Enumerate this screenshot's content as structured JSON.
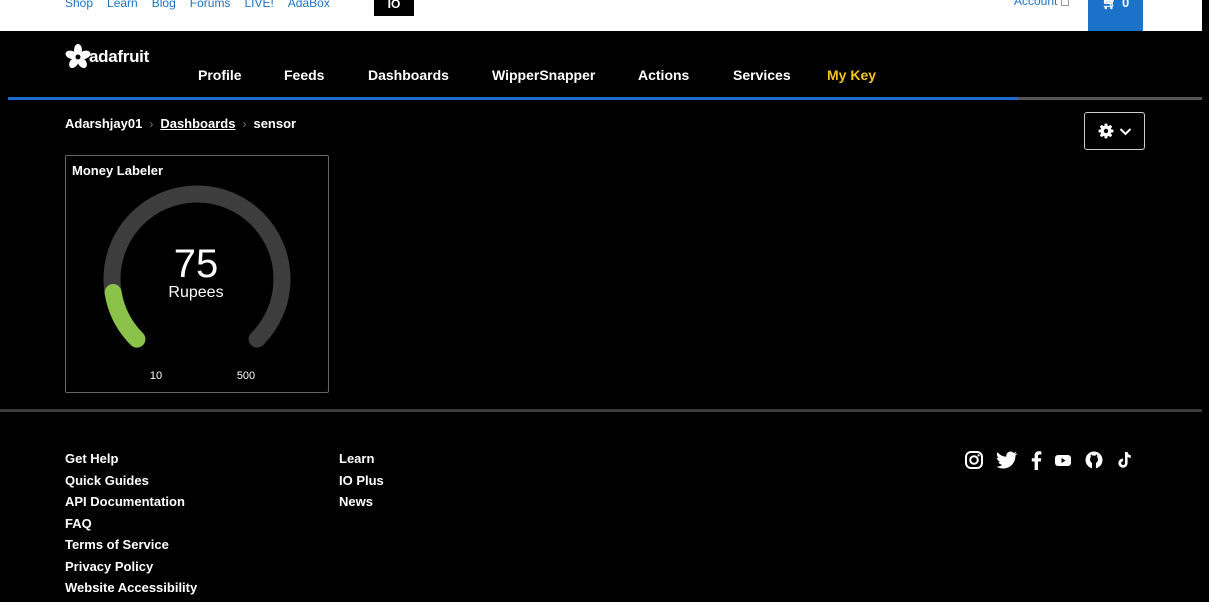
{
  "topbar": {
    "links": [
      "Shop",
      "Learn",
      "Blog",
      "Forums",
      "LIVE!",
      "AdaBox"
    ],
    "io_tab": "IO",
    "account": "Account",
    "cart_count": "0"
  },
  "brand": {
    "name": "adafruit"
  },
  "nav": {
    "items": [
      "Profile",
      "Feeds",
      "Dashboards",
      "WipperSnapper",
      "Actions",
      "Services"
    ],
    "highlight": "My Key",
    "highlight_color": "#f5c518"
  },
  "breadcrumb": {
    "user": "Adarshjay01",
    "section": "Dashboards",
    "current": "sensor"
  },
  "widget": {
    "title": "Money Labeler",
    "value": "75",
    "unit": "Rupees",
    "min": "10",
    "max": "500",
    "fill_fraction": 0.1327,
    "fill_color": "#8bc34a"
  },
  "footer": {
    "col1": [
      "Get Help",
      "Quick Guides",
      "API Documentation",
      "FAQ",
      "Terms of Service",
      "Privacy Policy",
      "Website Accessibility"
    ],
    "col2": [
      "Learn",
      "IO Plus",
      "News"
    ],
    "social_icons": [
      "instagram-icon",
      "twitter-icon",
      "facebook-icon",
      "youtube-icon",
      "github-icon",
      "tiktok-icon"
    ]
  },
  "colors": {
    "accent_blue": "#1b72c9",
    "nav_bar": "#1d6bd0"
  }
}
